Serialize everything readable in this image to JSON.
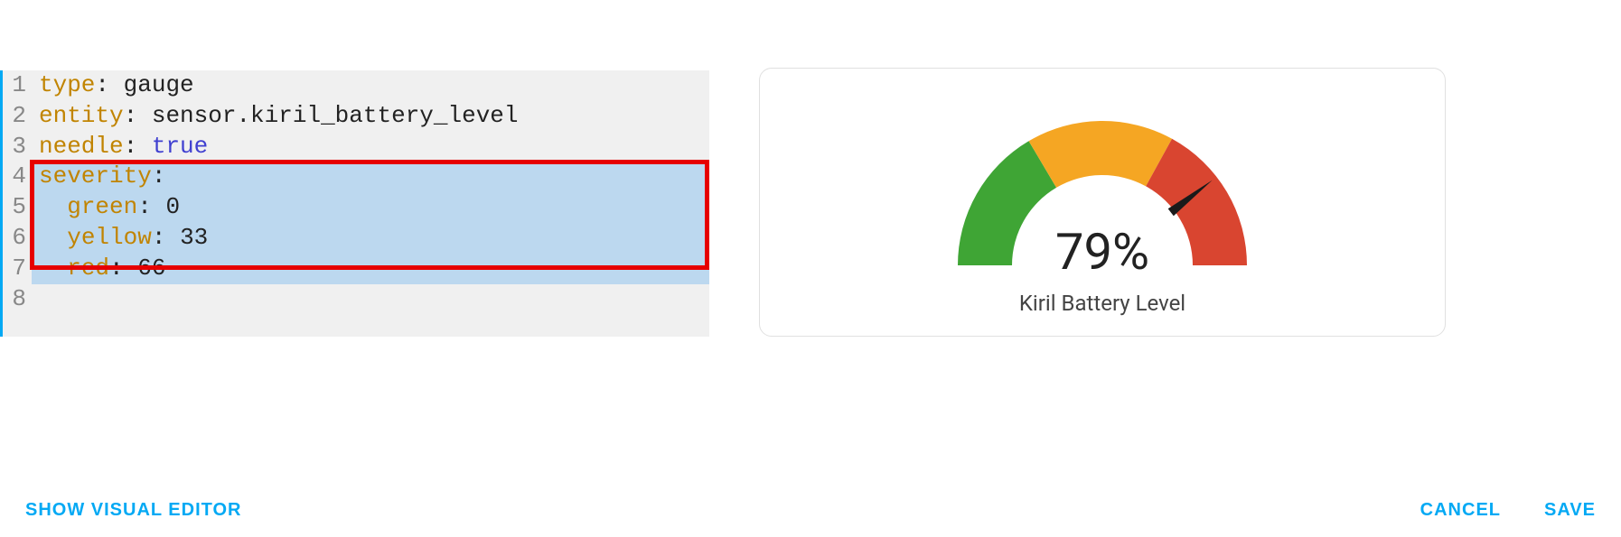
{
  "editor": {
    "lines": [
      {
        "n": "1",
        "segments": [
          {
            "cls": "tok-key",
            "t": "type"
          },
          {
            "cls": "tok-colon",
            "t": ": "
          },
          {
            "cls": "tok-scalar",
            "t": "gauge"
          }
        ],
        "hl": false
      },
      {
        "n": "2",
        "segments": [
          {
            "cls": "tok-key",
            "t": "entity"
          },
          {
            "cls": "tok-colon",
            "t": ": "
          },
          {
            "cls": "tok-scalar",
            "t": "sensor.kiril_battery_level"
          }
        ],
        "hl": false
      },
      {
        "n": "3",
        "segments": [
          {
            "cls": "tok-key",
            "t": "needle"
          },
          {
            "cls": "tok-colon",
            "t": ": "
          },
          {
            "cls": "tok-bool",
            "t": "true"
          }
        ],
        "hl": false
      },
      {
        "n": "4",
        "segments": [
          {
            "cls": "tok-key",
            "t": "severity"
          },
          {
            "cls": "tok-colon",
            "t": ":"
          }
        ],
        "hl": true
      },
      {
        "n": "5",
        "segments": [
          {
            "cls": "",
            "t": "  "
          },
          {
            "cls": "tok-key",
            "t": "green"
          },
          {
            "cls": "tok-colon",
            "t": ": "
          },
          {
            "cls": "tok-num",
            "t": "0"
          }
        ],
        "hl": true
      },
      {
        "n": "6",
        "segments": [
          {
            "cls": "",
            "t": "  "
          },
          {
            "cls": "tok-key",
            "t": "yellow"
          },
          {
            "cls": "tok-colon",
            "t": ": "
          },
          {
            "cls": "tok-num",
            "t": "33"
          }
        ],
        "hl": true
      },
      {
        "n": "7",
        "segments": [
          {
            "cls": "",
            "t": "  "
          },
          {
            "cls": "tok-key",
            "t": "red"
          },
          {
            "cls": "tok-colon",
            "t": ": "
          },
          {
            "cls": "tok-num",
            "t": "66"
          }
        ],
        "hl": true
      },
      {
        "n": "8",
        "segments": [],
        "hl": false
      }
    ]
  },
  "gauge": {
    "value_display": "79%",
    "value": 79,
    "label": "Kiril Battery Level",
    "severity": {
      "green": 0,
      "yellow": 33,
      "red": 66,
      "max": 100
    },
    "colors": {
      "green": "#3fa535",
      "yellow": "#f5a623",
      "red": "#d94530",
      "needle": "#1a1a1a"
    }
  },
  "footer": {
    "show_visual": "SHOW VISUAL EDITOR",
    "cancel": "CANCEL",
    "save": "SAVE"
  }
}
